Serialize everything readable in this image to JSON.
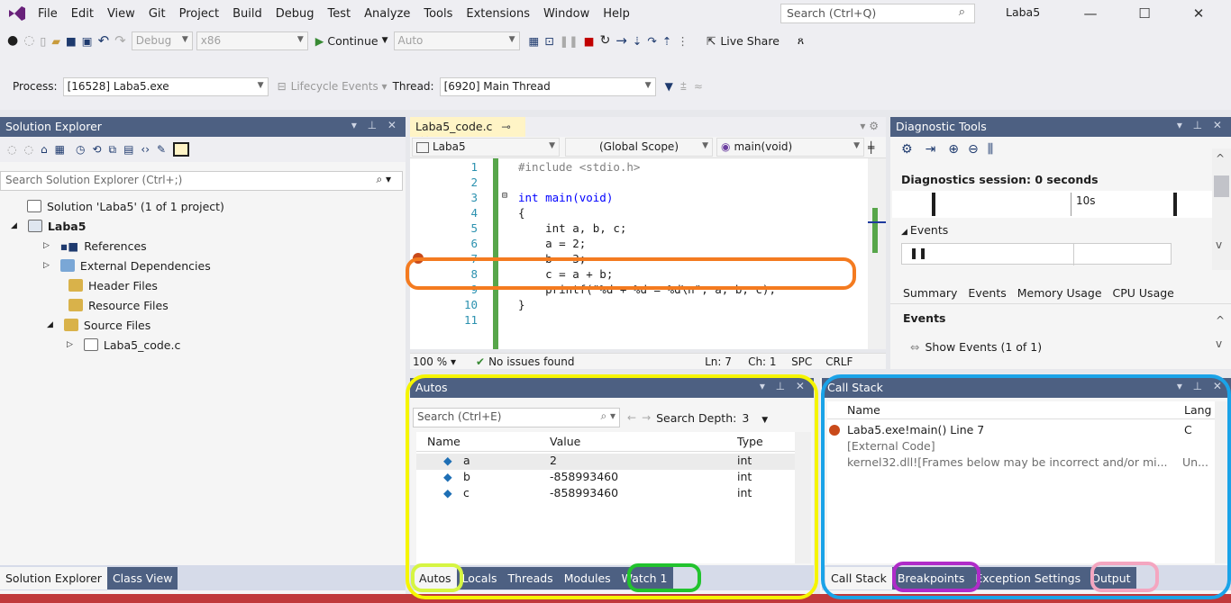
{
  "menubar": {
    "items": [
      "File",
      "Edit",
      "View",
      "Git",
      "Project",
      "Build",
      "Debug",
      "Test",
      "Analyze",
      "Tools",
      "Extensions",
      "Window",
      "Help"
    ],
    "search_placeholder": "Search (Ctrl+Q)",
    "solution_name": "Laba5"
  },
  "toolbar": {
    "config": "Debug",
    "platform": "x86",
    "continue_label": "Continue",
    "auto_label": "Auto",
    "live_share": "Live Share"
  },
  "processbar": {
    "process_label": "Process:",
    "process_value": "[16528] Laba5.exe",
    "lifecycle_label": "Lifecycle Events",
    "thread_label": "Thread:",
    "thread_value": "[6920] Main Thread"
  },
  "solution_explorer": {
    "title": "Solution Explorer",
    "search_placeholder": "Search Solution Explorer (Ctrl+;)",
    "tree": [
      {
        "label": "Solution 'Laba5' (1 of 1 project)"
      },
      {
        "label": "Laba5"
      },
      {
        "label": "References"
      },
      {
        "label": "External Dependencies"
      },
      {
        "label": "Header Files"
      },
      {
        "label": "Resource Files"
      },
      {
        "label": "Source Files"
      },
      {
        "label": "Laba5_code.c"
      }
    ],
    "tabs": [
      "Solution Explorer",
      "Class View"
    ]
  },
  "editor": {
    "tab_label": "Laba5_code.c",
    "nav_project": "Laba5",
    "nav_scope": "(Global Scope)",
    "nav_function": "main(void)",
    "lines": [
      {
        "n": "1",
        "code": "#include <stdio.h>"
      },
      {
        "n": "2",
        "code": ""
      },
      {
        "n": "3",
        "code": "int main(void)"
      },
      {
        "n": "4",
        "code": "{"
      },
      {
        "n": "5",
        "code": "    int a, b, c;"
      },
      {
        "n": "6",
        "code": "    a = 2;"
      },
      {
        "n": "7",
        "code": "    b = 3;"
      },
      {
        "n": "8",
        "code": "    c = a + b;"
      },
      {
        "n": "9",
        "code": "    printf(\"%d + %d = %d\\n\", a, b, c);"
      },
      {
        "n": "10",
        "code": "}"
      },
      {
        "n": "11",
        "code": ""
      }
    ],
    "zoom": "100 %",
    "issues": "No issues found",
    "ln": "Ln: 7",
    "ch": "Ch: 1",
    "spc": "SPC",
    "crlf": "CRLF"
  },
  "diagnostic": {
    "title": "Diagnostic Tools",
    "session": "Diagnostics session: 0 seconds",
    "tick_10s": "10s",
    "events_header": "Events",
    "tabs": [
      "Summary",
      "Events",
      "Memory Usage",
      "CPU Usage"
    ],
    "events_label": "Events",
    "show_events": "Show Events (1 of 1)"
  },
  "autos": {
    "title": "Autos",
    "search_placeholder": "Search (Ctrl+E)",
    "search_depth_label": "Search Depth:",
    "search_depth_value": "3",
    "columns": [
      "Name",
      "Value",
      "Type"
    ],
    "rows": [
      {
        "name": "a",
        "value": "2",
        "type": "int"
      },
      {
        "name": "b",
        "value": "-858993460",
        "type": "int"
      },
      {
        "name": "c",
        "value": "-858993460",
        "type": "int"
      }
    ],
    "tabs": [
      "Autos",
      "Locals",
      "Threads",
      "Modules",
      "Watch 1"
    ]
  },
  "callstack": {
    "title": "Call Stack",
    "columns": [
      "Name",
      "Lang"
    ],
    "rows": [
      {
        "name": "Laba5.exe!main() Line 7",
        "lang": "C"
      },
      {
        "name": "[External Code]",
        "lang": ""
      },
      {
        "name": "kernel32.dll![Frames below may be incorrect and/or mi...",
        "lang": "Un..."
      }
    ],
    "tabs": [
      "Call Stack",
      "Breakpoints",
      "Exception Settings",
      "Output"
    ]
  },
  "colors": {
    "highlight_orange": "#f47b20",
    "highlight_yellow": "#f5f500",
    "highlight_blue": "#1aa3e8",
    "highlight_green": "#22c32e",
    "highlight_purple": "#b02bc9",
    "highlight_pink": "#f4a6c0",
    "highlight_lime": "#d6f542"
  }
}
